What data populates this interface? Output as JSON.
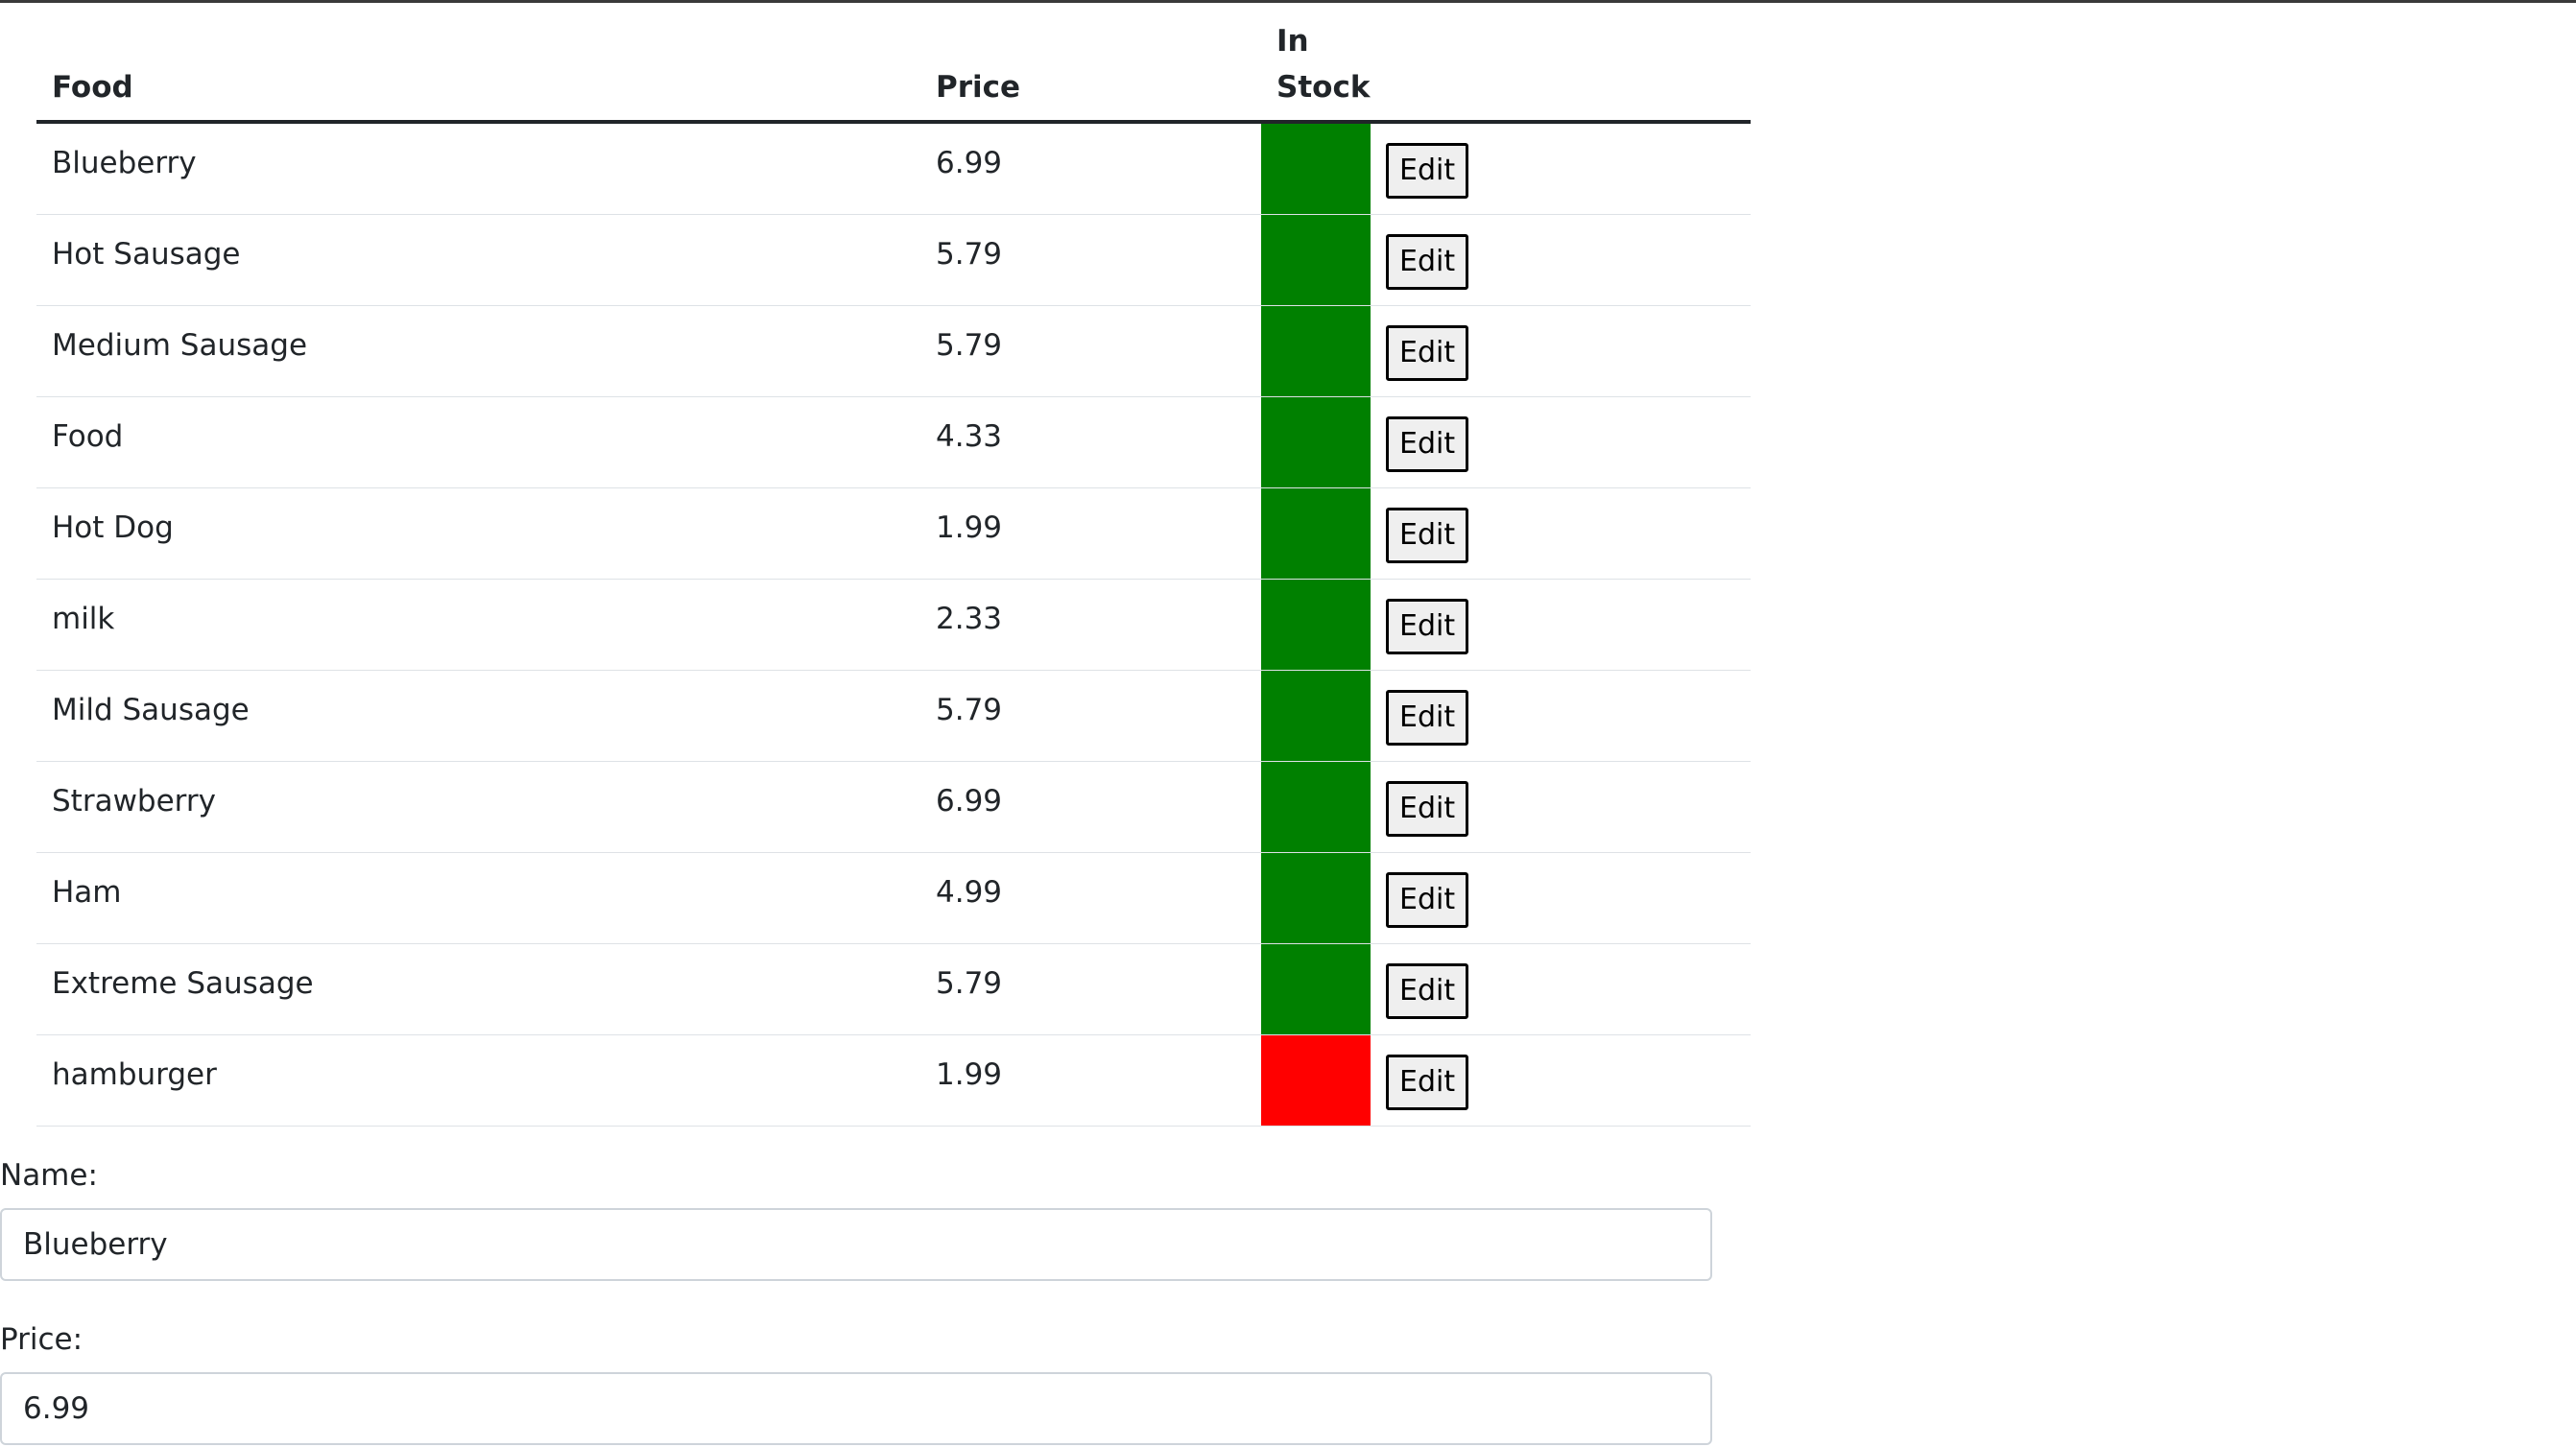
{
  "table": {
    "headers": {
      "food": "Food",
      "price": "Price",
      "in_stock": "In Stock"
    },
    "edit_label": "Edit",
    "rows": [
      {
        "food": "Blueberry",
        "price": "6.99",
        "in_stock": true
      },
      {
        "food": "Hot Sausage",
        "price": "5.79",
        "in_stock": true
      },
      {
        "food": "Medium Sausage",
        "price": "5.79",
        "in_stock": true
      },
      {
        "food": "Food",
        "price": "4.33",
        "in_stock": true
      },
      {
        "food": "Hot Dog",
        "price": "1.99",
        "in_stock": true
      },
      {
        "food": "milk",
        "price": "2.33",
        "in_stock": true
      },
      {
        "food": "Mild Sausage",
        "price": "5.79",
        "in_stock": true
      },
      {
        "food": "Strawberry",
        "price": "6.99",
        "in_stock": true
      },
      {
        "food": "Ham",
        "price": "4.99",
        "in_stock": true
      },
      {
        "food": "Extreme Sausage",
        "price": "5.79",
        "in_stock": true
      },
      {
        "food": "hamburger",
        "price": "1.99",
        "in_stock": false
      }
    ]
  },
  "colors": {
    "in_stock": "#008000",
    "out_of_stock": "#ff0000"
  },
  "form": {
    "name_label": "Name:",
    "name_value": "Blueberry",
    "price_label": "Price:",
    "price_value": "6.99"
  }
}
